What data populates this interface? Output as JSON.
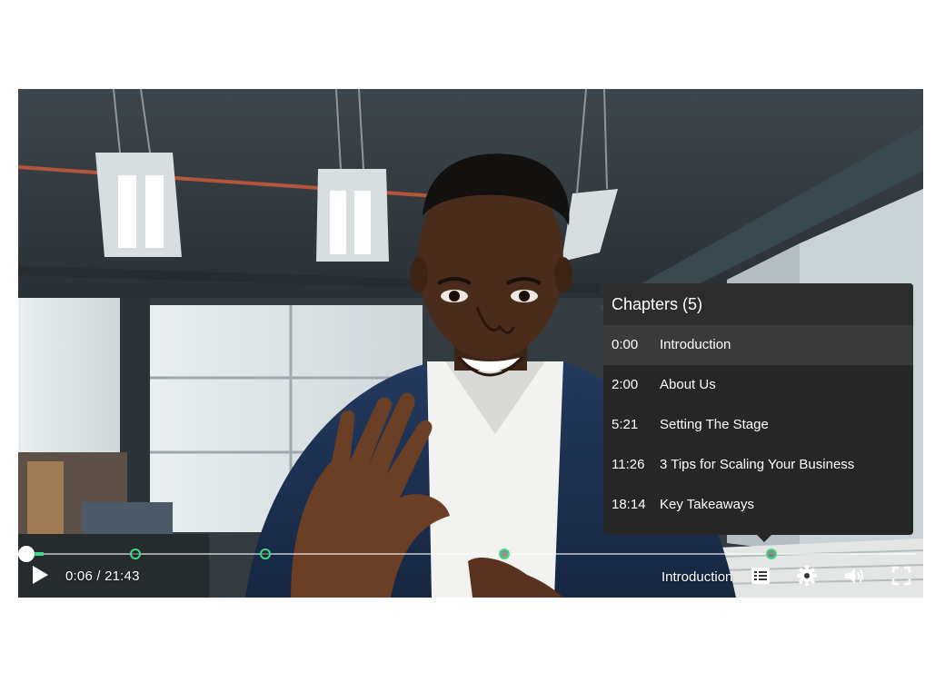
{
  "player": {
    "current_time": "0:06",
    "duration": "21:43",
    "time_display": "0:06 / 21:43",
    "progress": 0.0046,
    "current_chapter": "Introduction",
    "accent_color": "#3ddc84",
    "icons": [
      "play-icon",
      "chapters-icon",
      "settings-icon",
      "volume-icon",
      "fullscreen-icon"
    ]
  },
  "chapters": {
    "title": "Chapters (5)",
    "items": [
      {
        "time": "0:00",
        "label": "Introduction"
      },
      {
        "time": "2:00",
        "label": "About Us"
      },
      {
        "time": "5:21",
        "label": "Setting The Stage"
      },
      {
        "time": "11:26",
        "label": "3 Tips for Scaling Your Business"
      },
      {
        "time": "18:14",
        "label": "Key Takeaways"
      }
    ]
  }
}
